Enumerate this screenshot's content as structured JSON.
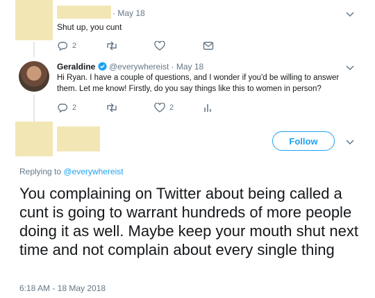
{
  "tweet1": {
    "time": "· May 18",
    "text": "Shut up, you cunt",
    "reply_count": "2"
  },
  "tweet2": {
    "name": "Geraldine",
    "handle_time": "@everywhereist · May 18",
    "text_line1": "Hi Ryan. I have a couple of questions, and I wonder if you'd be willing to answer",
    "text_line2": "them. Let me know! Firstly, do you say things like this to women in person?",
    "reply_count": "2",
    "like_count": "2"
  },
  "main_tweet": {
    "follow_label": "Follow",
    "replying_prefix": "Replying to ",
    "replying_handle": "@everywhereist",
    "text": "You complaining on Twitter about being called a cunt is going to warrant hundreds of more people doing it as well. Maybe keep your mouth shut next time and not complain about every single thing",
    "timestamp": "6:18 AM - 18 May 2018"
  },
  "colors": {
    "accent": "#1da1f2",
    "muted": "#657786",
    "redaction": "#f3e6b5",
    "verified": "#1da1f2"
  },
  "icons": [
    "reply-icon",
    "retweet-icon",
    "like-icon",
    "dm-icon",
    "analytics-icon",
    "chevron-down-icon",
    "verified-icon"
  ]
}
